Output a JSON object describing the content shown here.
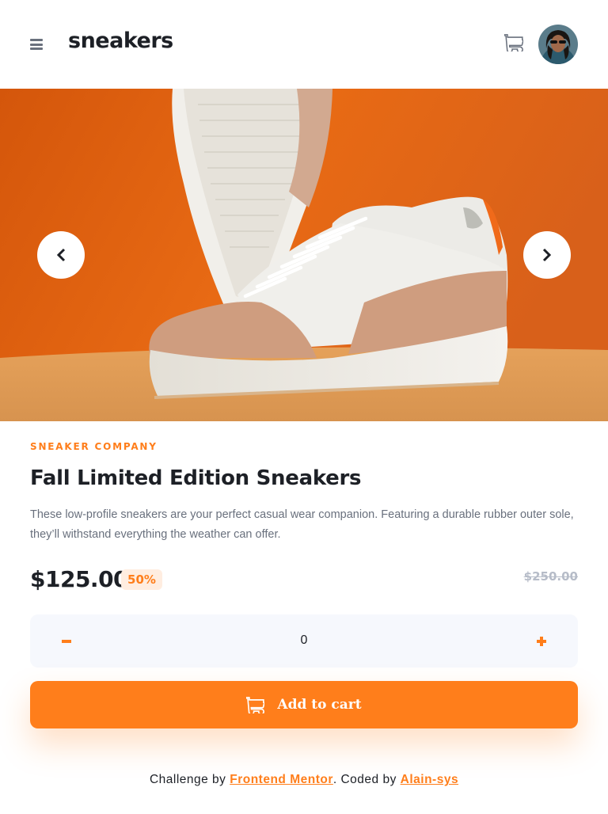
{
  "header": {
    "logo": "sneakers",
    "icons": {
      "menu": "menu-icon",
      "cart": "cart-icon",
      "avatar": "avatar"
    }
  },
  "gallery": {
    "prev_icon": "chevron-left-icon",
    "next_icon": "chevron-right-icon"
  },
  "product": {
    "company": "SNEAKER COMPANY",
    "title": "Fall Limited Edition Sneakers",
    "description": "These low-profile sneakers are your perfect casual wear companion. Featuring a durable rubber outer sole, they’ll withstand everything the weather can offer.",
    "price": "$125.00",
    "discount": "50%",
    "original_price": "$250.00"
  },
  "quantity": {
    "value": "0",
    "minus_icon": "minus-icon",
    "plus_icon": "plus-icon"
  },
  "cart_button": {
    "label": "Add to cart",
    "icon": "cart-icon"
  },
  "footer": {
    "prefix": "Challenge by ",
    "link1": "Frontend Mentor",
    "middle": ". Coded by ",
    "link2": "Alain-sys"
  },
  "colors": {
    "accent": "#ff7e1b",
    "accent_light": "#ffede0",
    "dark": "#1d2026",
    "grey": "#69707d",
    "muted": "#b6bcc8",
    "light_bg": "#f6f8fd"
  }
}
